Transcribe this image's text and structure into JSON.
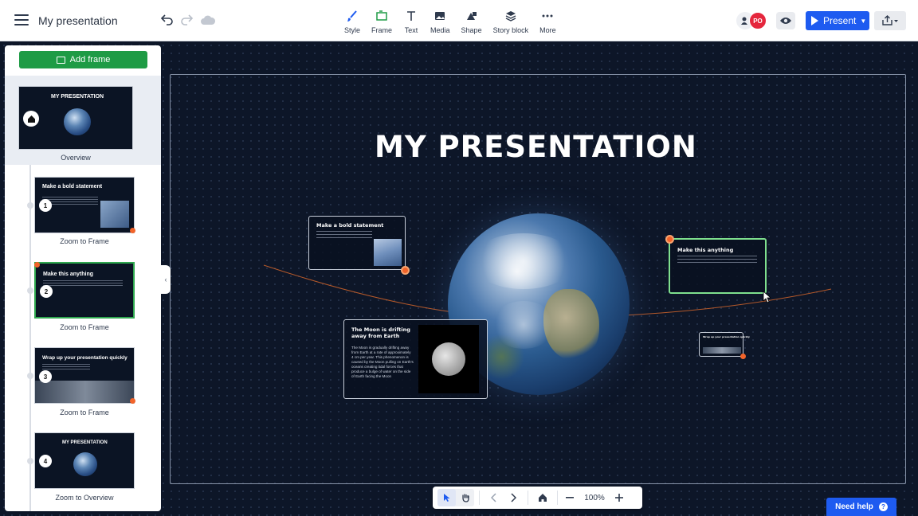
{
  "app": {
    "title": "My presentation"
  },
  "toolbar": {
    "tools": [
      {
        "label": "Style",
        "icon": "brush-icon"
      },
      {
        "label": "Frame",
        "icon": "frame-icon"
      },
      {
        "label": "Text",
        "icon": "text-icon"
      },
      {
        "label": "Media",
        "icon": "image-icon"
      },
      {
        "label": "Shape",
        "icon": "shape-icon"
      },
      {
        "label": "Story block",
        "icon": "layers-icon"
      },
      {
        "label": "More",
        "icon": "more-icon"
      }
    ],
    "collaborator_initials": "PO",
    "present_label": "Present"
  },
  "sidebar": {
    "add_frame_label": "Add frame",
    "overview_label": "Overview",
    "items": [
      {
        "number": "1",
        "title": "Make a bold statement",
        "label": "Zoom to Frame"
      },
      {
        "number": "2",
        "title": "Make this anything",
        "label": "Zoom to Frame"
      },
      {
        "number": "3",
        "title": "Wrap up your presentation quickly",
        "label": "Zoom to Frame"
      },
      {
        "number": "4",
        "title": "MY PRESENTATION",
        "label": "Zoom to Overview"
      }
    ],
    "overview_thumb_title": "MY PRESENTATION"
  },
  "canvas": {
    "title": "MY PRESENTATION",
    "cards": {
      "bold": {
        "title": "Make a bold statement"
      },
      "anything": {
        "title": "Make this anything"
      },
      "moon": {
        "title": "The Moon is drifting away from Earth",
        "body": "The Moon is gradually drifting away from Earth at a rate of approximately 4 cm per year. This phenomenon is caused by the Moon pulling on Earth's oceans creating tidal forces that produce a bulge of water on the side of Earth facing the Moon"
      },
      "wrap": {
        "title": "Wrap up your presentation quickly"
      }
    }
  },
  "bottom_bar": {
    "zoom": "100%"
  },
  "help": {
    "label": "Need help"
  },
  "colors": {
    "accent": "#1e5bf0",
    "add_frame": "#1e9b45",
    "selection": "#7fe08e",
    "pin": "#f2642a"
  }
}
